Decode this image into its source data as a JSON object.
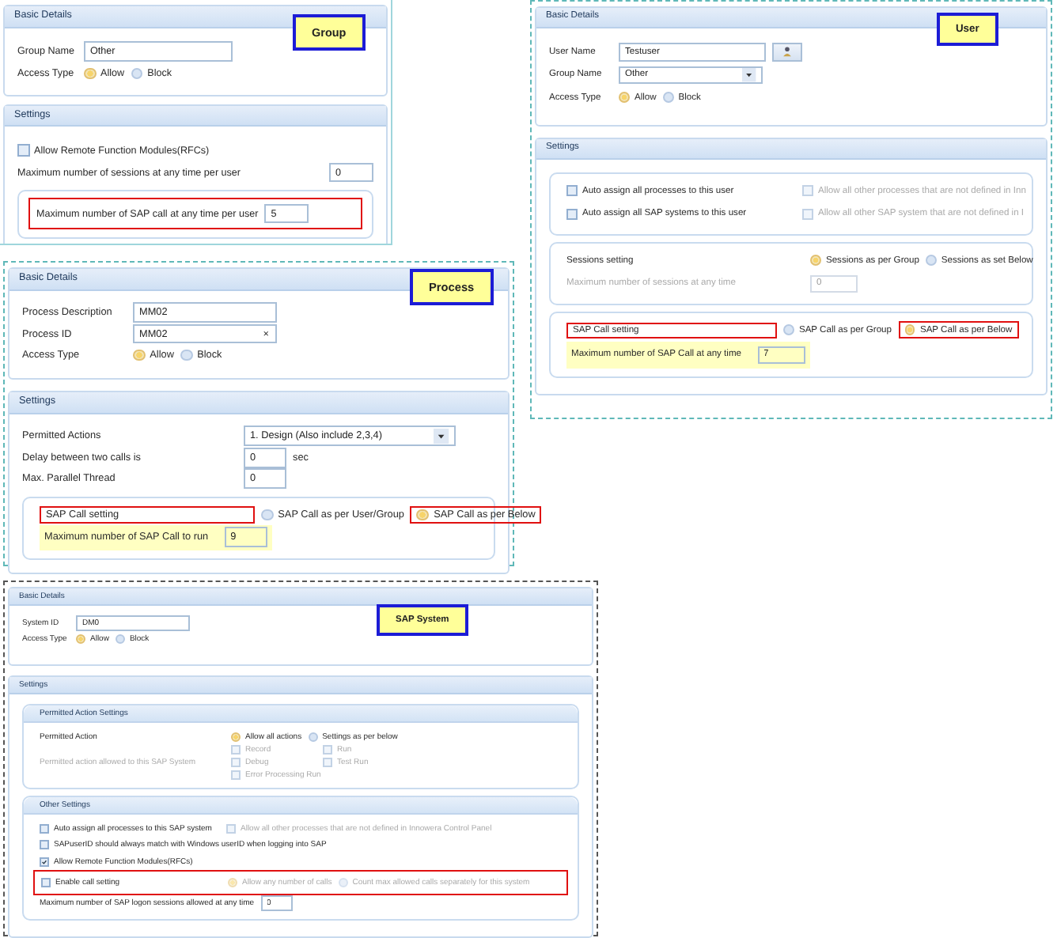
{
  "panels": [
    {
      "badge": "Group",
      "sections": [
        {
          "header": "Basic Details",
          "boxes": [
            {
              "kind": "plain",
              "rows": [
                {
                  "items": [
                    {
                      "kind": "label",
                      "text": "Group Name"
                    },
                    {
                      "kind": "input",
                      "value": "Other"
                    }
                  ]
                },
                {
                  "items": [
                    {
                      "kind": "label",
                      "text": "Access Type"
                    },
                    {
                      "kind": "radio",
                      "label": "Allow",
                      "selected": true,
                      "disabled": false
                    },
                    {
                      "kind": "radio",
                      "label": "Block",
                      "selected": false,
                      "disabled": false
                    }
                  ]
                }
              ]
            }
          ]
        },
        {
          "header": "Settings",
          "boxes": [
            {
              "kind": "plain",
              "rows": [
                {
                  "items": [
                    {
                      "kind": "checkbox",
                      "label": "Allow Remote Function Modules(RFCs)",
                      "checked": false,
                      "disabled": false
                    }
                  ]
                },
                {
                  "items": [
                    {
                      "kind": "label",
                      "text": "Maximum number of sessions at any time per user"
                    },
                    {
                      "kind": "input",
                      "value": "0"
                    }
                  ]
                }
              ]
            },
            {
              "kind": "framed",
              "rows": [
                {
                  "outlined": true,
                  "items": [
                    {
                      "kind": "label",
                      "text": "Maximum number of SAP call at any time per user"
                    },
                    {
                      "kind": "input",
                      "value": "5"
                    }
                  ]
                }
              ]
            }
          ]
        }
      ]
    },
    {
      "badge": "User",
      "sections": [
        {
          "header": "Basic Details",
          "boxes": [
            {
              "kind": "plain",
              "rows": [
                {
                  "items": [
                    {
                      "kind": "label",
                      "text": "User Name"
                    },
                    {
                      "kind": "input",
                      "value": "Testuser"
                    },
                    {
                      "kind": "picker"
                    }
                  ]
                },
                {
                  "items": [
                    {
                      "kind": "label",
                      "text": "Group Name"
                    },
                    {
                      "kind": "select",
                      "value": "Other"
                    }
                  ]
                },
                {
                  "items": [
                    {
                      "kind": "label",
                      "text": "Access Type"
                    },
                    {
                      "kind": "radio",
                      "label": "Allow",
                      "selected": true,
                      "disabled": false
                    },
                    {
                      "kind": "radio",
                      "label": "Block",
                      "selected": false,
                      "disabled": false
                    }
                  ]
                }
              ]
            }
          ]
        },
        {
          "header": "Settings",
          "boxes": [
            {
              "kind": "framed",
              "rows": [
                {
                  "items": [
                    {
                      "kind": "checkbox",
                      "label": "Auto assign all processes to this user",
                      "checked": false,
                      "disabled": false
                    },
                    {
                      "kind": "checkbox",
                      "label": "Allow all other processes that are not defined in Inn",
                      "checked": false,
                      "disabled": true
                    }
                  ]
                },
                {
                  "items": [
                    {
                      "kind": "checkbox",
                      "label": "Auto assign all SAP systems to this user",
                      "checked": false,
                      "disabled": false
                    },
                    {
                      "kind": "checkbox",
                      "label": "Allow all other SAP system that are not defined in I",
                      "checked": false,
                      "disabled": true
                    }
                  ]
                }
              ]
            },
            {
              "kind": "framed",
              "rows": [
                {
                  "items": [
                    {
                      "kind": "label",
                      "text": "Sessions setting"
                    },
                    {
                      "kind": "radio",
                      "label": "Sessions as per Group",
                      "selected": true,
                      "disabled": false
                    },
                    {
                      "kind": "radio",
                      "label": "Sessions as set Below",
                      "selected": false,
                      "disabled": false
                    }
                  ]
                },
                {
                  "items": [
                    {
                      "kind": "hint",
                      "text": "Maximum number of sessions at any time"
                    },
                    {
                      "kind": "input",
                      "value": "0",
                      "disabled": true
                    }
                  ]
                }
              ]
            },
            {
              "kind": "framed",
              "rows": [
                {
                  "outlined": false,
                  "highlighted": false,
                  "items": [
                    {
                      "kind": "label",
                      "text": "SAP Call setting",
                      "outlined": true
                    },
                    {
                      "kind": "radio",
                      "label": "SAP Call as per Group",
                      "selected": false,
                      "disabled": false,
                      "outlined": false
                    },
                    {
                      "kind": "radio",
                      "label": "SAP Call as per Below",
                      "selected": true,
                      "disabled": false,
                      "outlined": true
                    }
                  ]
                },
                {
                  "outlined": false,
                  "highlighted": true,
                  "items": [
                    {
                      "kind": "label",
                      "text": "Maximum number of SAP Call at any time"
                    },
                    {
                      "kind": "input",
                      "value": "7"
                    }
                  ]
                }
              ]
            }
          ]
        }
      ]
    },
    {
      "badge": "Process",
      "sections": [
        {
          "header": "Basic Details",
          "boxes": [
            {
              "kind": "plain",
              "rows": [
                {
                  "items": [
                    {
                      "kind": "label",
                      "text": "Process Description"
                    },
                    {
                      "kind": "input",
                      "value": "MM02"
                    }
                  ]
                },
                {
                  "items": [
                    {
                      "kind": "label",
                      "text": "Process ID"
                    },
                    {
                      "kind": "input",
                      "value": "MM02",
                      "clear": "×"
                    }
                  ]
                },
                {
                  "items": [
                    {
                      "kind": "label",
                      "text": "Access Type"
                    },
                    {
                      "kind": "radio",
                      "label": "Allow",
                      "selected": true,
                      "disabled": false
                    },
                    {
                      "kind": "radio",
                      "label": "Block",
                      "selected": false,
                      "disabled": false
                    }
                  ]
                }
              ]
            }
          ]
        },
        {
          "header": "Settings",
          "boxes": [
            {
              "kind": "plain",
              "rows": [
                {
                  "items": [
                    {
                      "kind": "label",
                      "text": "Permitted Actions"
                    },
                    {
                      "kind": "select",
                      "value": "1. Design (Also include 2,3,4)"
                    }
                  ]
                },
                {
                  "items": [
                    {
                      "kind": "label",
                      "text": "Delay between two calls is"
                    },
                    {
                      "kind": "input",
                      "value": "0"
                    },
                    {
                      "kind": "label",
                      "text": "sec"
                    }
                  ]
                },
                {
                  "items": [
                    {
                      "kind": "label",
                      "text": "Max. Parallel Thread"
                    },
                    {
                      "kind": "input",
                      "value": "0"
                    }
                  ]
                }
              ]
            },
            {
              "kind": "framed",
              "rows": [
                {
                  "outlined": false,
                  "highlighted": false,
                  "items": [
                    {
                      "kind": "label",
                      "text": "SAP Call setting",
                      "outlined": true
                    },
                    {
                      "kind": "radio",
                      "label": "SAP Call as per User/Group",
                      "selected": false,
                      "disabled": false,
                      "outlined": false
                    },
                    {
                      "kind": "radio",
                      "label": "SAP Call as per Below",
                      "selected": true,
                      "disabled": false,
                      "outlined": true
                    }
                  ]
                },
                {
                  "outlined": false,
                  "highlighted": true,
                  "items": [
                    {
                      "kind": "label",
                      "text": "Maximum number of SAP Call to run"
                    },
                    {
                      "kind": "input",
                      "value": "9"
                    }
                  ]
                }
              ]
            }
          ]
        }
      ]
    },
    {
      "badge": "SAP System",
      "sections": [
        {
          "header": "Basic Details",
          "boxes": [
            {
              "kind": "plain",
              "rows": [
                {
                  "items": [
                    {
                      "kind": "label",
                      "text": "System ID"
                    },
                    {
                      "kind": "input",
                      "value": "DM0"
                    }
                  ]
                },
                {
                  "items": [
                    {
                      "kind": "label",
                      "text": "Access Type"
                    },
                    {
                      "kind": "radio",
                      "label": "Allow",
                      "selected": true,
                      "disabled": false
                    },
                    {
                      "kind": "radio",
                      "label": "Block",
                      "selected": false,
                      "disabled": false
                    }
                  ]
                }
              ]
            }
          ]
        },
        {
          "header": "Settings",
          "boxes": [
            {
              "kind": "framed",
              "title": "Permitted Action Settings",
              "rows": [
                {
                  "items": [
                    {
                      "kind": "label",
                      "text": "Permitted Action"
                    },
                    {
                      "kind": "radio",
                      "label": "Allow all actions",
                      "selected": true,
                      "disabled": false
                    },
                    {
                      "kind": "radio",
                      "label": "Settings as per below",
                      "selected": false,
                      "disabled": false
                    }
                  ]
                },
                {
                  "items": [
                    {
                      "kind": "hint",
                      "text": "Permitted action allowed to this SAP System"
                    },
                    {
                      "kind": "checklist",
                      "options": [
                        {
                          "label": "Record",
                          "checked": false,
                          "disabled": true
                        },
                        {
                          "label": "Run",
                          "checked": false,
                          "disabled": true
                        },
                        {
                          "label": "Debug",
                          "checked": false,
                          "disabled": true
                        },
                        {
                          "label": "Test Run",
                          "checked": false,
                          "disabled": true
                        },
                        {
                          "label": "Error Processing Run",
                          "checked": false,
                          "disabled": true
                        }
                      ]
                    }
                  ]
                }
              ]
            },
            {
              "kind": "framed",
              "title": "Other Settings",
              "rows": [
                {
                  "outlined": false,
                  "items": [
                    {
                      "kind": "checkbox",
                      "label": "Auto assign all processes to this SAP system",
                      "checked": false,
                      "disabled": false
                    },
                    {
                      "kind": "checkbox",
                      "label": "Allow all other processes that are not defined in Innowera Control Panel",
                      "checked": false,
                      "disabled": true
                    }
                  ]
                },
                {
                  "outlined": false,
                  "items": [
                    {
                      "kind": "checkbox",
                      "label": "SAPuserID should always match with Windows userID when logging into SAP",
                      "checked": false,
                      "disabled": false
                    }
                  ]
                },
                {
                  "outlined": false,
                  "items": [
                    {
                      "kind": "checkbox",
                      "label": "Allow Remote Function Modules(RFCs)",
                      "checked": true,
                      "disabled": false
                    }
                  ]
                },
                {
                  "outlined": true,
                  "items": [
                    {
                      "kind": "checkbox",
                      "label": "Enable call setting",
                      "checked": false,
                      "disabled": false
                    },
                    {
                      "kind": "radio",
                      "label": "Allow any number of calls",
                      "selected": true,
                      "disabled": true
                    },
                    {
                      "kind": "radio",
                      "label": "Count max allowed calls separately for this system",
                      "selected": false,
                      "disabled": true
                    }
                  ]
                },
                {
                  "outlined": false,
                  "items": [
                    {
                      "kind": "label",
                      "text": "Maximum number of SAP logon sessions allowed at any time"
                    },
                    {
                      "kind": "input",
                      "value": "0"
                    }
                  ]
                }
              ]
            }
          ]
        }
      ]
    }
  ]
}
